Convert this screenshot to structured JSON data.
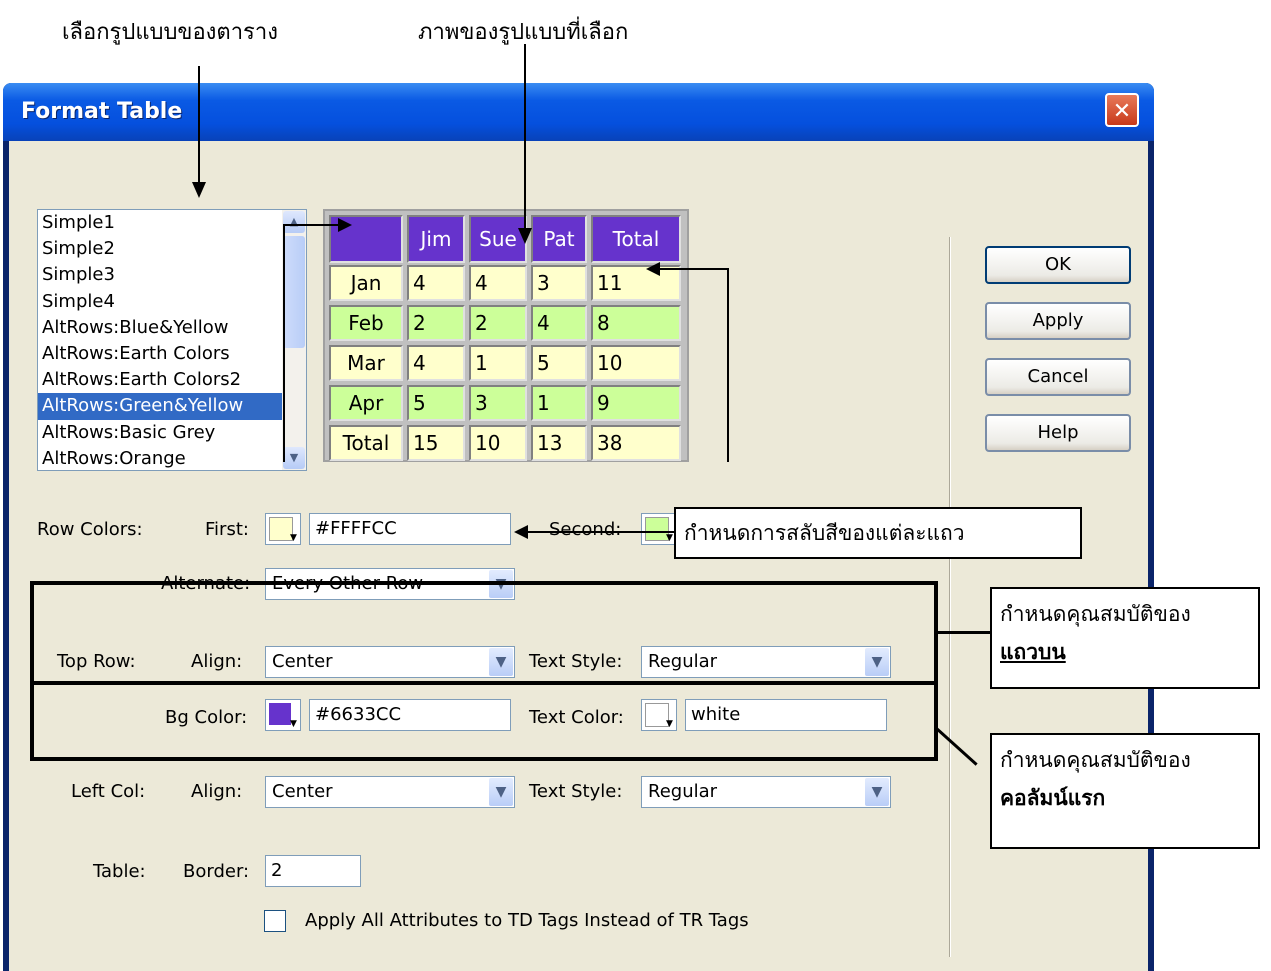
{
  "annotations": {
    "select_format": "เลือกรูปแบบของตาราง",
    "preview_image": "ภาพของรูปแบบที่เลือก",
    "alternate_note": "กำหนดการสลับสีของแต่ละแถว",
    "top_row_note_1": "กำหนดคุณสมบัติของ",
    "top_row_note_2": "แถวบน",
    "left_col_note_1": "กำหนดคุณสมบัติของ",
    "left_col_note_2": "คอลัมน์แรก"
  },
  "window": {
    "title": "Format Table",
    "close": "✕"
  },
  "format_list": {
    "items": [
      "Simple1",
      "Simple2",
      "Simple3",
      "Simple4",
      "AltRows:Blue&Yellow",
      "AltRows:Earth Colors",
      "AltRows:Earth Colors2",
      "AltRows:Green&Yellow",
      "AltRows:Basic Grey",
      "AltRows:Orange"
    ],
    "selected": "AltRows:Green&Yellow"
  },
  "preview": {
    "header": [
      "",
      "Jim",
      "Sue",
      "Pat",
      "Total"
    ],
    "rows": [
      [
        "Jan",
        "4",
        "4",
        "3",
        "11"
      ],
      [
        "Feb",
        "2",
        "2",
        "4",
        "8"
      ],
      [
        "Mar",
        "4",
        "1",
        "5",
        "10"
      ],
      [
        "Apr",
        "5",
        "3",
        "1",
        "9"
      ],
      [
        "Total",
        "15",
        "10",
        "13",
        "38"
      ]
    ]
  },
  "buttons": {
    "ok": "OK",
    "apply": "Apply",
    "cancel": "Cancel",
    "help": "Help"
  },
  "row_colors": {
    "label": "Row Colors:",
    "first_label": "First:",
    "first_value": "#FFFFCC",
    "second_label": "Second:",
    "second_value": "#CCFF99",
    "alternate_label": "Alternate:",
    "alternate_value": "Every Other Row"
  },
  "top_row": {
    "label": "Top Row:",
    "align_label": "Align:",
    "align_value": "Center",
    "text_style_label": "Text Style:",
    "text_style_value": "Regular",
    "bg_color_label": "Bg Color:",
    "bg_color_value": "#6633CC",
    "text_color_label": "Text Color:",
    "text_color_value": "white"
  },
  "left_col": {
    "label": "Left Col:",
    "align_label": "Align:",
    "align_value": "Center",
    "text_style_label": "Text Style:",
    "text_style_value": "Regular"
  },
  "table": {
    "label": "Table:",
    "border_label": "Border:",
    "border_value": "2"
  },
  "td_checkbox": {
    "label": "Apply All Attributes to TD Tags Instead of TR Tags",
    "checked": false
  },
  "colors": {
    "first": "#ffffcc",
    "second": "#ccff99",
    "top_bg": "#6633cc",
    "text": "#ffffff",
    "title_bar": "#0a5ae4"
  }
}
